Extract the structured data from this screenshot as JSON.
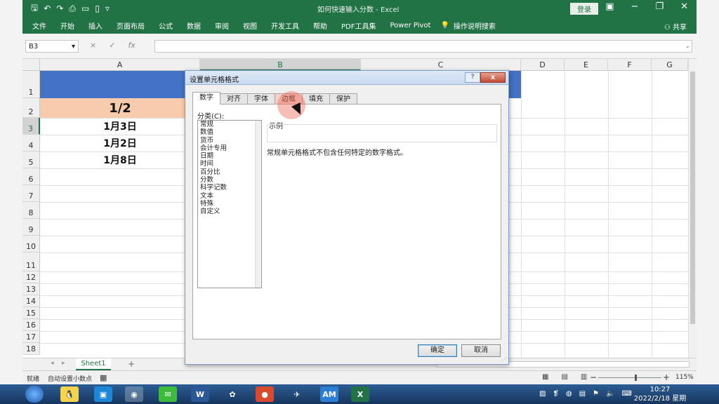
{
  "window": {
    "title": "如何快速输入分数 - Excel",
    "login": "登录"
  },
  "qat": {
    "icons": [
      "save-icon",
      "undo-icon",
      "redo-icon",
      "print-preview-icon",
      "open-icon",
      "new-icon",
      "customize-icon"
    ]
  },
  "ribbon": {
    "tabs": [
      "文件",
      "开始",
      "插入",
      "页面布局",
      "公式",
      "数据",
      "审阅",
      "视图",
      "开发工具",
      "帮助",
      "PDF工具集",
      "Power Pivot"
    ],
    "tellme": "操作说明搜索",
    "share": "共享"
  },
  "formula_bar": {
    "name_box": "B3",
    "fx_label": "fx",
    "cancel": "×",
    "enter": "✓",
    "value": ""
  },
  "grid": {
    "columns": [
      "A",
      "B",
      "C",
      "D",
      "E",
      "F",
      "G"
    ],
    "rows": [
      "1",
      "2",
      "3",
      "4",
      "5",
      "6",
      "7",
      "8",
      "9",
      "10",
      "11",
      "12",
      "13",
      "14",
      "15",
      "16",
      "17",
      "18"
    ],
    "cells": {
      "A2": "1/2",
      "A3": "1月3日",
      "A4": "1月2日",
      "A5": "1月8日"
    },
    "header_fill": "#4472c4",
    "a2_fill": "#f8cbad"
  },
  "sheets": {
    "tabs": [
      "Sheet1"
    ],
    "add": "+"
  },
  "status": {
    "ready": "就绪",
    "autodecimal": "自动设置小数点",
    "zoom": "115%",
    "zoom_minus": "−",
    "zoom_plus": "+"
  },
  "dialog": {
    "title": "设置单元格格式",
    "help": "?",
    "close": "x",
    "tabs": [
      "数字",
      "对齐",
      "字体",
      "边框",
      "填充",
      "保护"
    ],
    "active_tab": "数字",
    "hover_tab": "边框",
    "category_label": "分类(C):",
    "categories": [
      "常规",
      "数值",
      "货币",
      "会计专用",
      "日期",
      "时间",
      "百分比",
      "分数",
      "科学记数",
      "文本",
      "特殊",
      "自定义"
    ],
    "sample_label": "示例",
    "description": "常规单元格格式不包含任何特定的数字格式。",
    "ok": "确定",
    "cancel": "取消"
  },
  "taskbar": {
    "apps": [
      "qq-icon",
      "maxthon-icon",
      "media-icon",
      "wechat-icon",
      "word-icon",
      "paint-icon",
      "browser-icon",
      "feishu-icon",
      "am-icon",
      "excel-icon"
    ],
    "word_label": "W",
    "am_label": "AM",
    "excel_label": "X",
    "time": "10:27",
    "date": "2022/2/18 星期五"
  },
  "colors": {
    "excel_green": "#217346",
    "accent_blue": "#4472c4"
  }
}
